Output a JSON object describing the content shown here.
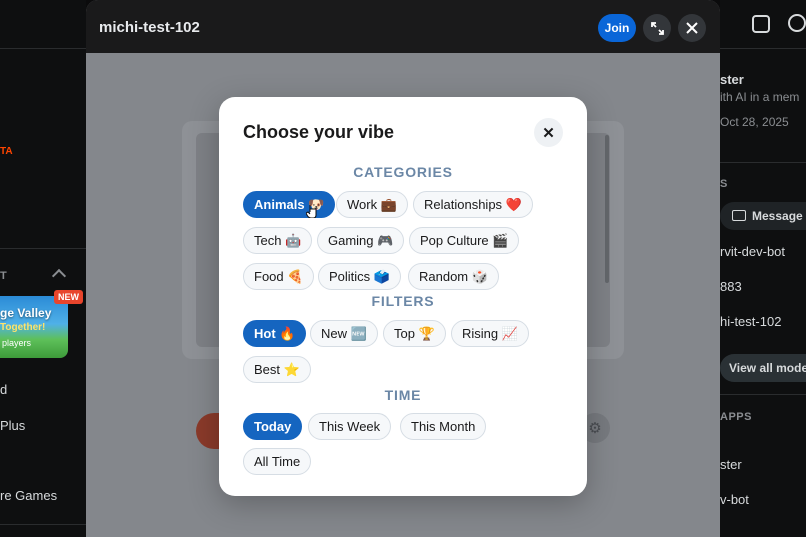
{
  "left_sidebar": {
    "orange_label": "TA",
    "section_label": "T",
    "game_card": {
      "title": "ge Valley",
      "subtitle": "Together!",
      "players": "players",
      "badge": "NEW"
    },
    "items": [
      "d",
      "Plus",
      "re Games"
    ]
  },
  "window": {
    "title": "michi-test-102",
    "join_label": "Join",
    "expand_icon": "expand-icon",
    "close_icon": "close-icon"
  },
  "dialog": {
    "title": "Choose your vibe",
    "close_glyph": "✕",
    "sections": {
      "categories": "CATEGORIES",
      "filters": "FILTERS",
      "time": "TIME"
    },
    "categories": [
      {
        "label": "Animals 🐶",
        "selected": true
      },
      {
        "label": "Work 💼",
        "selected": false
      },
      {
        "label": "Relationships ❤️",
        "selected": false
      },
      {
        "label": "Tech 🤖",
        "selected": false
      },
      {
        "label": "Gaming 🎮",
        "selected": false
      },
      {
        "label": "Pop Culture 🎬",
        "selected": false
      },
      {
        "label": "Food 🍕",
        "selected": false
      },
      {
        "label": "Politics 🗳️",
        "selected": false
      },
      {
        "label": "Random 🎲",
        "selected": false
      }
    ],
    "filters": [
      {
        "label": "Hot 🔥",
        "selected": true
      },
      {
        "label": "New 🆕",
        "selected": false
      },
      {
        "label": "Top 🏆",
        "selected": false
      },
      {
        "label": "Rising 📈",
        "selected": false
      },
      {
        "label": "Best ⭐",
        "selected": false
      }
    ],
    "time": [
      {
        "label": "Today",
        "selected": true
      },
      {
        "label": "This Week",
        "selected": false
      },
      {
        "label": "This Month",
        "selected": false
      },
      {
        "label": "All Time",
        "selected": false
      }
    ]
  },
  "right_sidebar": {
    "owner_name": "ster",
    "owner_desc": "ith AI in a mem",
    "owner_date": "Oct 28, 2025",
    "mods_label": "S",
    "message_button": "Message M",
    "mods": [
      "rvit-dev-bot",
      "883",
      "hi-test-102"
    ],
    "view_all": "View all moder",
    "apps_label": "APPS",
    "apps": [
      "ster",
      "v-bot"
    ]
  }
}
